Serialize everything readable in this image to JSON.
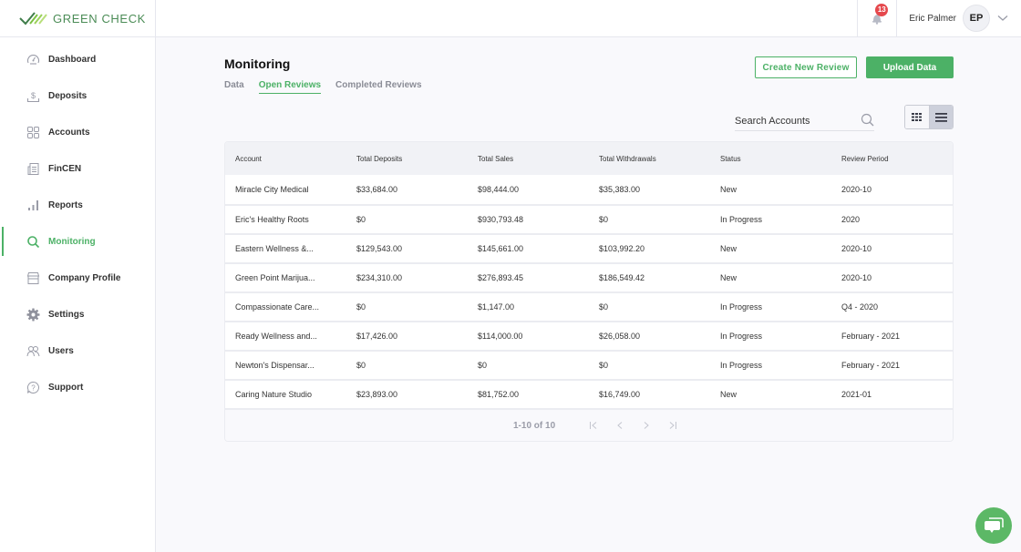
{
  "header": {
    "brand": "GREEN CHECK",
    "notifications_count": "13",
    "user_name": "Eric Palmer",
    "user_initials": "EP"
  },
  "sidebar": {
    "items": [
      {
        "label": "Dashboard",
        "icon": "dashboard-icon"
      },
      {
        "label": "Deposits",
        "icon": "deposit-icon"
      },
      {
        "label": "Accounts",
        "icon": "accounts-grid-icon"
      },
      {
        "label": "FinCEN",
        "icon": "document-icon"
      },
      {
        "label": "Reports",
        "icon": "bar-chart-icon"
      },
      {
        "label": "Monitoring",
        "icon": "search-icon",
        "active": true
      },
      {
        "label": "Company Profile",
        "icon": "storefront-icon"
      },
      {
        "label": "Settings",
        "icon": "gear-icon"
      },
      {
        "label": "Users",
        "icon": "users-icon"
      },
      {
        "label": "Support",
        "icon": "help-icon"
      }
    ]
  },
  "main": {
    "title": "Monitoring",
    "tabs": [
      {
        "label": "Data"
      },
      {
        "label": "Open Reviews",
        "active": true
      },
      {
        "label": "Completed Reviews"
      }
    ],
    "create_button": "Create New Review",
    "upload_button": "Upload Data",
    "search_placeholder": "Search Accounts"
  },
  "table": {
    "columns": [
      "Account",
      "Total Deposits",
      "Total Sales",
      "Total Withdrawals",
      "Status",
      "Review Period"
    ],
    "rows": [
      [
        "Miracle City Medical",
        "$33,684.00",
        "$98,444.00",
        "$35,383.00",
        "New",
        "2020-10"
      ],
      [
        "Eric's Healthy Roots",
        "$0",
        "$930,793.48",
        "$0",
        "In Progress",
        "2020"
      ],
      [
        "Eastern Wellness &...",
        "$129,543.00",
        "$145,661.00",
        "$103,992.20",
        "New",
        "2020-10"
      ],
      [
        "Green Point Marijua...",
        "$234,310.00",
        "$276,893.45",
        "$186,549.42",
        "New",
        "2020-10"
      ],
      [
        "Compassionate Care...",
        "$0",
        "$1,147.00",
        "$0",
        "In Progress",
        "Q4 - 2020"
      ],
      [
        "Ready Wellness and...",
        "$17,426.00",
        "$114,000.00",
        "$26,058.00",
        "In Progress",
        "February - 2021"
      ],
      [
        "Newton's Dispensar...",
        "$0",
        "$0",
        "$0",
        "In Progress",
        "February - 2021"
      ],
      [
        "Caring Nature Studio",
        "$23,893.00",
        "$81,752.00",
        "$16,749.00",
        "New",
        "2021-01"
      ]
    ],
    "pagination": "1-10 of 10"
  },
  "colors": {
    "accent": "#4cb166",
    "badge": "#e5484d"
  }
}
